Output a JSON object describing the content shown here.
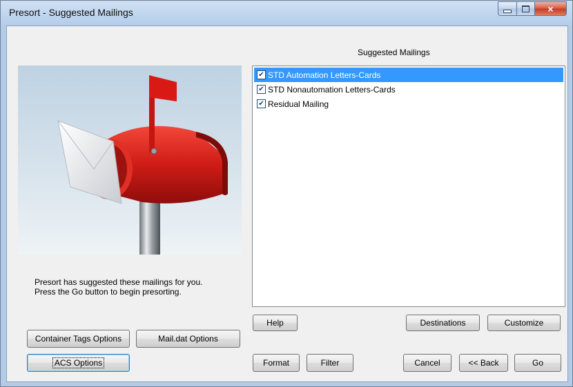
{
  "window": {
    "title": "Presort - Suggested Mailings",
    "caption_buttons": {
      "minimize": "minimize-icon",
      "maximize": "maximize-icon",
      "close": "×"
    }
  },
  "section_title": "Suggested Mailings",
  "image": {
    "icon": "mailbox-illustration"
  },
  "message": {
    "line1": "Presort has suggested these mailings for you.",
    "line2": "Press the Go button to begin presorting."
  },
  "mailings": [
    {
      "label": "STD Automation Letters-Cards",
      "checked": true,
      "selected": true
    },
    {
      "label": "STD Nonautomation Letters-Cards",
      "checked": true,
      "selected": false
    },
    {
      "label": "Residual Mailing",
      "checked": true,
      "selected": false
    }
  ],
  "buttons": {
    "help": "Help",
    "destinations": "Destinations",
    "customize": "Customize",
    "container_tags": "Container Tags Options",
    "maildat": "Mail.dat Options",
    "acs": "ACS Options",
    "format": "Format",
    "filter": "Filter",
    "cancel": "Cancel",
    "back": "<< Back",
    "go": "Go"
  },
  "colors": {
    "selection": "#3399ff",
    "mailbox_red": "#d8201c",
    "titlebar": "#bfd5ee"
  }
}
